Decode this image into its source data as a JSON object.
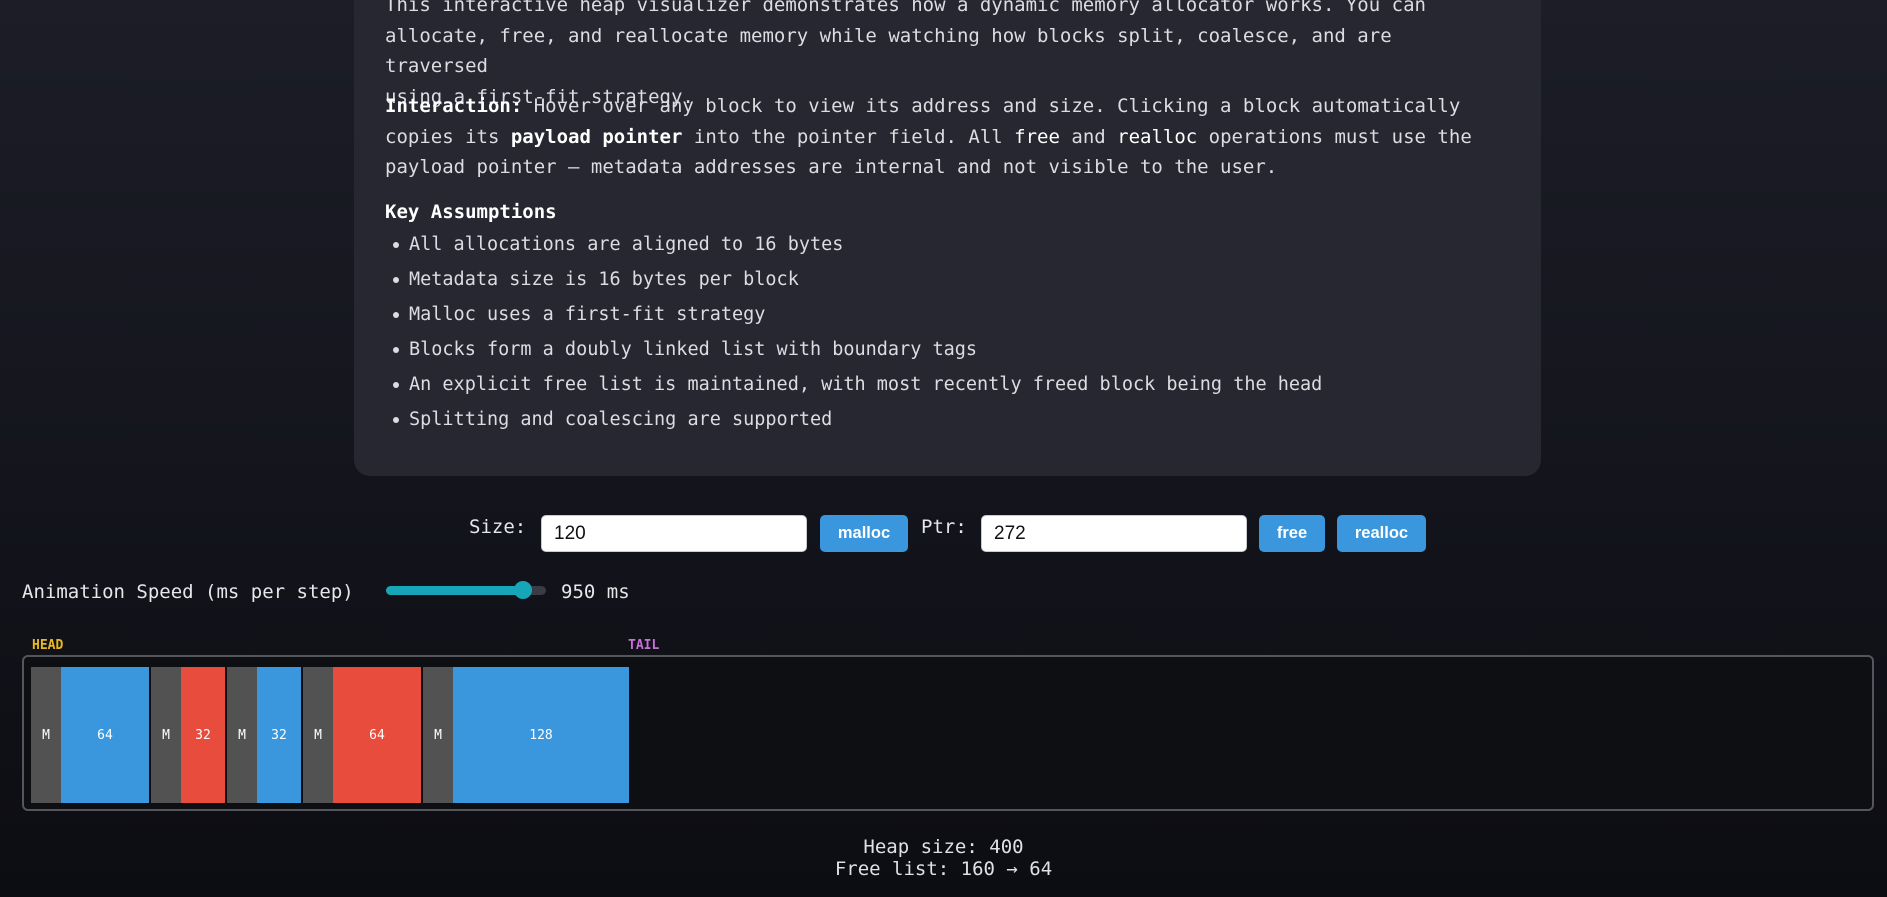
{
  "description": {
    "intro_line1": "This interactive heap visualizer demonstrates how a dynamic memory allocator works. You can",
    "intro_line2": "allocate, free, and reallocate memory while watching how blocks split, coalesce, and are traversed",
    "intro_line3": "using a first-fit strategy.",
    "interaction_label": "Interaction:",
    "interaction_text1": " Hover over any block to view its address and size. Clicking a block automatically",
    "interaction_text2": "copies its ",
    "interaction_bold": "payload pointer",
    "interaction_text3": " into the pointer field. All ",
    "interaction_free": "free",
    "interaction_and": " and ",
    "interaction_realloc": "realloc",
    "interaction_text4": " operations must use the",
    "interaction_text5": "payload pointer — metadata addresses are internal and not visible to the user.",
    "assumptions_title": "Key Assumptions",
    "assumptions": [
      "All allocations are aligned to 16 bytes",
      "Metadata size is 16 bytes per block",
      "Malloc uses a first-fit strategy",
      "Blocks form a doubly linked list with boundary tags",
      "An explicit free list is maintained, with most recently freed block being the head",
      "Splitting and coalescing are supported"
    ]
  },
  "controls": {
    "size_label": "Size:",
    "size_value": "120",
    "malloc_label": "malloc",
    "ptr_label": "Ptr:",
    "ptr_value": "272",
    "free_label": "free",
    "realloc_label": "realloc"
  },
  "speed": {
    "label": "Animation Speed (ms per step)",
    "value_text": "950 ms",
    "level": 0.9
  },
  "heap": {
    "head_label": "HEAD",
    "tail_label": "TAIL",
    "meta_label": "M",
    "blocks": [
      {
        "size": "64",
        "state": "free"
      },
      {
        "size": "32",
        "state": "used"
      },
      {
        "size": "32",
        "state": "free"
      },
      {
        "size": "64",
        "state": "used"
      },
      {
        "size": "128",
        "state": "free"
      }
    ],
    "colors": {
      "meta": "#525252",
      "free": "#3a97dd",
      "used": "#e74c3c",
      "head": "#e8b923",
      "tail": "#c86fd8"
    }
  },
  "stats": {
    "heap_size": "Heap size: 400",
    "free_list": "Free list: 160 → 64"
  }
}
